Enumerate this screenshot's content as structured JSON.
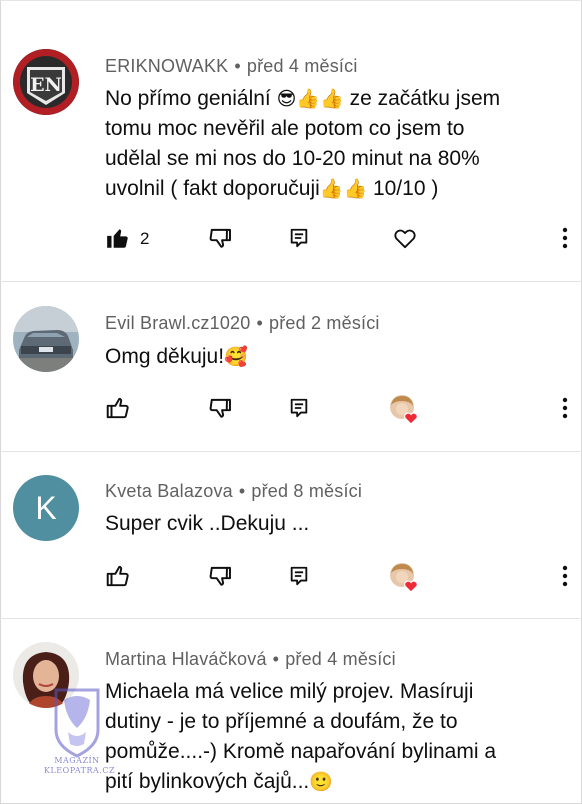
{
  "comments": [
    {
      "author": "ERIKNOWAKK",
      "separator": "•",
      "time": "před 4 měsíci",
      "line1": "No přímo geniální",
      "line1_emoji": "😎👍👍",
      "line1_rest": " ze začátku jsem",
      "line2": "tomu moc nevěřil ale potom co jsem to",
      "line3": "udělal se mi nos do 10-20 minut na 80%",
      "line4": "uvolnil ( fakt doporučuji",
      "line4_emoji": "👍👍",
      "line4_rest": " 10/10  )",
      "likes": "2",
      "avatar_text": "EN"
    },
    {
      "author": "Evil Brawl.cz1020",
      "separator": "•",
      "time": "před 2 měsíci",
      "line1": "Omg děkuju!",
      "line1_emoji": "🥰"
    },
    {
      "author": "Kveta Balazova",
      "separator": "•",
      "time": "před 8 měsíci",
      "line1": "Super cvik ..Dekuju ...",
      "avatar_letter": "K"
    },
    {
      "author": "Martina Hlaváčková",
      "separator": "•",
      "time": "před 4 měsíci",
      "line1": "Michaela má velice milý projev. Masíruji",
      "line2": "dutiny - je to příjemné a doufám, že to",
      "line3": "pomůže....-) Kromě napařování bylinami a",
      "line4": "pití bylinkových čajů...",
      "line4_emoji": "🙂"
    }
  ],
  "watermark": {
    "line1": "MAGAZÍN",
    "line2": "KLEOPATRA.CZ"
  },
  "icons": {
    "like": "thumb-up-icon",
    "dislike": "thumb-down-icon",
    "reply": "reply-icon",
    "heart": "heart-icon",
    "more": "more-vertical-icon"
  },
  "colors": {
    "meta_gray": "#606060",
    "avatar_k": "#4f8fa0",
    "heart_red": "#ee2a35"
  }
}
